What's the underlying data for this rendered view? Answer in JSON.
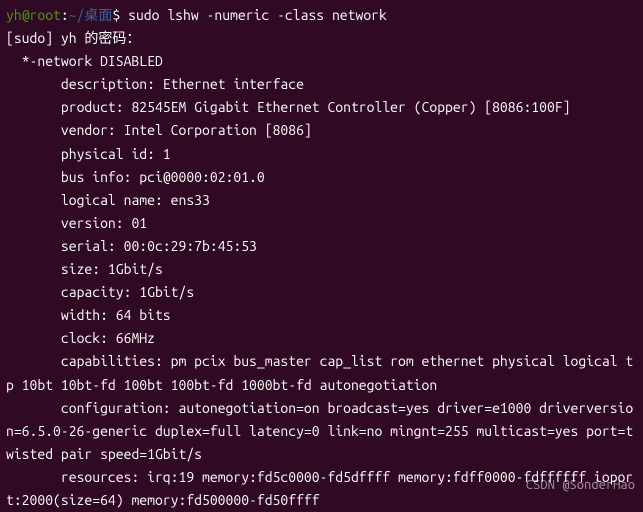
{
  "prompt": {
    "user": "yh",
    "at": "@",
    "host": "root",
    "colon": ":",
    "path": "~/桌面",
    "dollar": "$ ",
    "command": "sudo lshw -numeric -class network"
  },
  "lines": [
    "[sudo] yh 的密码：",
    "  *-network DISABLED",
    "       description: Ethernet interface",
    "       product: 82545EM Gigabit Ethernet Controller (Copper) [8086:100F]",
    "       vendor: Intel Corporation [8086]",
    "       physical id: 1",
    "       bus info: pci@0000:02:01.0",
    "       logical name: ens33",
    "       version: 01",
    "       serial: 00:0c:29:7b:45:53",
    "       size: 1Gbit/s",
    "       capacity: 1Gbit/s",
    "       width: 64 bits",
    "       clock: 66MHz",
    "       capabilities: pm pcix bus_master cap_list rom ethernet physical logical tp 10bt 10bt-fd 100bt 100bt-fd 1000bt-fd autonegotiation",
    "       configuration: autonegotiation=on broadcast=yes driver=e1000 driverversion=6.5.0-26-generic duplex=full latency=0 link=no mingnt=255 multicast=yes port=twisted pair speed=1Gbit/s",
    "       resources: irq:19 memory:fd5c0000-fd5dffff memory:fdff0000-fdffffff ioport:2000(size=64) memory:fd500000-fd50ffff"
  ],
  "watermark": "CSDN @SonderHao"
}
